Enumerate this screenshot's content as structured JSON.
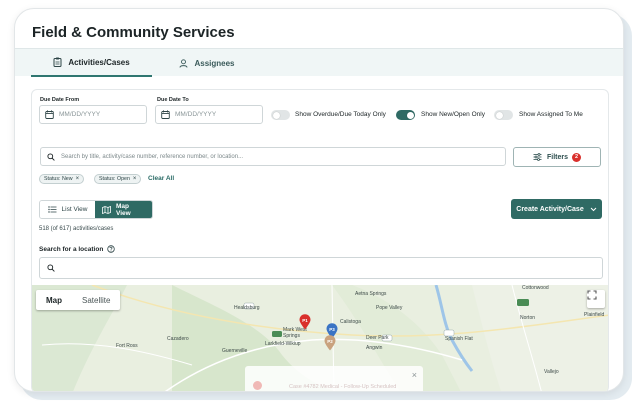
{
  "page": {
    "title": "Field & Community Services"
  },
  "tabs": [
    {
      "label": "Activities/Cases",
      "active": true
    },
    {
      "label": "Assignees",
      "active": false
    }
  ],
  "filters": {
    "due_from_label": "Due Date From",
    "due_from_placeholder": "MM/DD/YYYY",
    "due_to_label": "Due Date To",
    "due_to_placeholder": "MM/DD/YYYY",
    "toggles": [
      {
        "label": "Show Overdue/Due Today Only",
        "on": false
      },
      {
        "label": "Show New/Open Only",
        "on": true
      },
      {
        "label": "Show Assigned To Me",
        "on": false
      }
    ],
    "search_placeholder": "Search by title, activity/case number, reference number, or location...",
    "filters_button": "Filters",
    "filters_count": "2",
    "chips": [
      "Status: New",
      "Status: Open"
    ],
    "clear_all": "Clear All"
  },
  "view": {
    "list_label": "List View",
    "map_label": "Map View",
    "active": "map",
    "create_button": "Create Activity/Case",
    "count_text": "518 (of 617) activities/cases"
  },
  "map": {
    "search_label": "Search for a location",
    "type_map": "Map",
    "type_satellite": "Satellite",
    "places": [
      "Healdsburg",
      "Aetna Springs",
      "Pope Valley",
      "Mark West Springs",
      "Calistoga",
      "Cazadero",
      "Guerneville",
      "Larkfield-Wikiup",
      "Deer Park",
      "Fort Ross",
      "Angwin",
      "Spanish Flat",
      "Cottonwood",
      "Norton",
      "Plainfield",
      "Vallejo"
    ],
    "markers": [
      "P1",
      "P3",
      "P2"
    ],
    "popup_text": "Case #4782 Medical - Follow-Up Scheduled"
  },
  "colors": {
    "primary": "#2f6a64",
    "badge": "#d9302c",
    "marker_red": "#d9302c",
    "marker_blue": "#3b74c4",
    "marker_tan": "#c9a27e"
  }
}
